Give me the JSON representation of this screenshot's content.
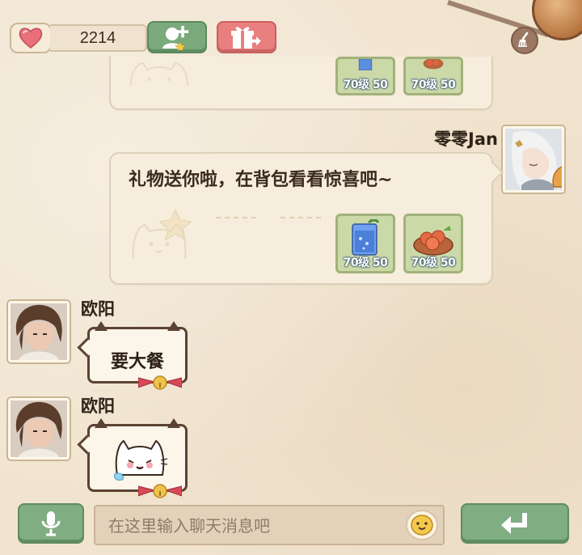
{
  "topbar": {
    "heart_count": "2214",
    "heart_icon": "heart-icon",
    "add_friend_icon": "add-friend-icon",
    "gift_icon": "gift-icon",
    "clear_icon": "broom-icon"
  },
  "colors": {
    "background": "#f1e4cf",
    "card": "#f6eddc",
    "green_button": "#80ad81",
    "pink_button": "#e97f7f",
    "item_tile": "#cbd9a9"
  },
  "messages": [
    {
      "items": [
        {
          "name": "blue-drink",
          "level": "70级 50"
        },
        {
          "name": "meat-dish",
          "level": "70级 50"
        }
      ]
    },
    {
      "sender": "零零Jan",
      "text": "礼物送你啦，在背包看看惊喜吧~",
      "items": [
        {
          "name": "blue-drink",
          "level": "70级 50"
        },
        {
          "name": "meat-dish",
          "level": "70级 50"
        }
      ]
    },
    {
      "sender": "欧阳",
      "text": "要大餐"
    },
    {
      "sender": "欧阳",
      "sticker": "crying-cat-sticker"
    }
  ],
  "input": {
    "placeholder": "在这里输入聊天消息吧",
    "mic_icon": "microphone-icon",
    "emoji_icon": "smiley-icon",
    "send_icon": "enter-arrow-icon"
  }
}
